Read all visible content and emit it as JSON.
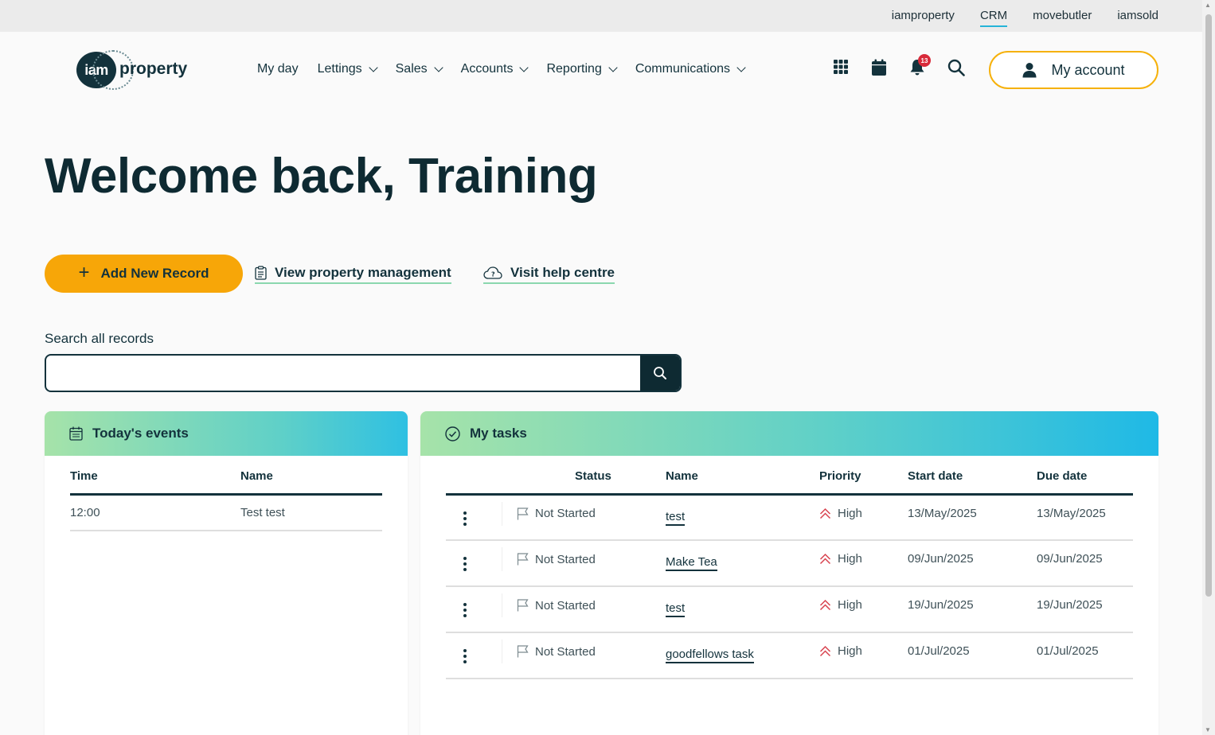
{
  "topbar": {
    "links": [
      "iamproperty",
      "CRM",
      "movebutler",
      "iamsold"
    ],
    "active": "CRM"
  },
  "brand": {
    "mark": "iam",
    "word": "property"
  },
  "nav": {
    "items": [
      "My day",
      "Lettings",
      "Sales",
      "Accounts",
      "Reporting",
      "Communications"
    ]
  },
  "header_icons": {
    "apps": "grid-icon",
    "calendar": "calendar-icon",
    "notifications": "bell-icon",
    "notifications_count": "13",
    "search": "search-icon"
  },
  "account": {
    "label": "My account"
  },
  "hero": {
    "title": "Welcome back, Training"
  },
  "actions": {
    "add_record": "Add New Record",
    "view_pm": "View property management",
    "help": "Visit help centre"
  },
  "search": {
    "label": "Search all records",
    "value": "",
    "placeholder": ""
  },
  "events": {
    "title": "Today's events",
    "columns": [
      "Time",
      "Name"
    ],
    "rows": [
      {
        "time": "12:00",
        "name": "Test test"
      }
    ]
  },
  "tasks": {
    "title": "My tasks",
    "columns": [
      "Status",
      "Name",
      "Priority",
      "Start date",
      "Due date"
    ],
    "rows": [
      {
        "status": "Not Started",
        "name": "test",
        "priority": "High",
        "start": "13/May/2025",
        "due": "13/May/2025"
      },
      {
        "status": "Not Started",
        "name": "Make Tea",
        "priority": "High",
        "start": "09/Jun/2025",
        "due": "09/Jun/2025"
      },
      {
        "status": "Not Started",
        "name": "test",
        "priority": "High",
        "start": "19/Jun/2025",
        "due": "19/Jun/2025"
      },
      {
        "status": "Not Started",
        "name": "goodfellows task",
        "priority": "High",
        "start": "01/Jul/2025",
        "due": "01/Jul/2025"
      }
    ]
  },
  "colors": {
    "brand_dark": "#13323c",
    "accent_yellow": "#f7a608",
    "priority_high": "#d8434f",
    "badge_red": "#d82a3a"
  }
}
